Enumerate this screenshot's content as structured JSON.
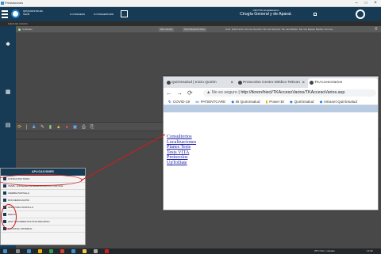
{
  "os_window": {
    "title": "Prestaciones"
  },
  "header": {
    "org_name": "QPQUONSTRURL SGFR",
    "nav_left": "% INTEGERS",
    "nav_right": "% INTEGERS MID",
    "center_line1": "CMTYPA  Hospitalización",
    "center_line2": "Cirugía General y de Aparat."
  },
  "breadcrumb": "MAPA DE CAMAS",
  "filters": {
    "left_label": "Unidades",
    "chip1": "Mis Camas",
    "chip2": "Tipo Paciente Vista",
    "chip3": "Unid. Enfermería: Sin uso  Servicio: Sin uso  Sección: Sin uso  Médico: Sin uso  Equipo Médico: Sin uso"
  },
  "toolbar_icons": [
    "refresh-icon",
    "person-icon",
    "edit-icon",
    "grid-icon",
    "chart-icon",
    "document-icon",
    "print-icon"
  ],
  "browser": {
    "tabs": [
      {
        "label": "Quirónsalud | Inicio Quirón"
      },
      {
        "label": "Protocolos Centro Médico Teknon"
      },
      {
        "label": "TKAccesoVarios"
      }
    ],
    "address_warning": "No es seguro",
    "address_url": "http://tknon/hiscl/TKAccesoVarios/TKAccesoVarios.asp",
    "bookmarks": [
      "COVID-19",
      "PATIENTCARE",
      "BI Quironsalud",
      "Power BI",
      "Quirónsalud",
      "Intranet Quirónsalud"
    ],
    "links": [
      "Consultorios",
      "Localizaciones",
      "Planes Tesis",
      "Tesis VITA",
      "Protocolos",
      "UpToDate"
    ]
  },
  "apps_menu": {
    "title": "APLICACIONES",
    "items": [
      "CONSULTAS TESIS",
      "TESIS - EXPEDIENTE ADMINISTRATIVO VIRTUAL",
      "CIERRE PANTALLA",
      "DOCUEDUCACIÓN",
      "APERTURA PANTALLA",
      "WebVil",
      "HIST. MOVIMIENTOS POR RECURSO",
      "NACIONAL MATERIAL"
    ]
  },
  "taskbar": {
    "status": "25°C  Parc. soleado",
    "clock": "13:09"
  },
  "colors": {
    "header": "#173a55",
    "annotation": "#d21c1c",
    "link": "#1a1aa6"
  }
}
